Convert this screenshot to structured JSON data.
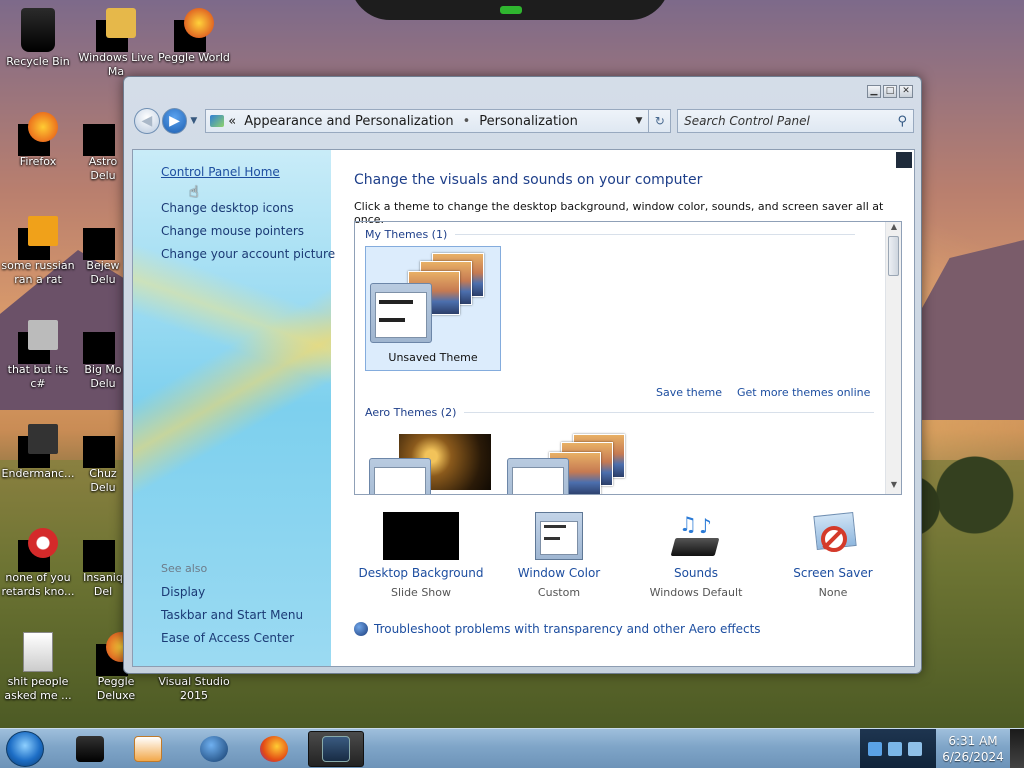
{
  "desktop": {
    "icons": [
      {
        "label": "Recycle Bin",
        "icon": "recycle-bin-icon"
      },
      {
        "label": "Windows Live Ma",
        "icon": "windows-live-icon"
      },
      {
        "label": "Peggle World",
        "icon": "peggle-icon"
      },
      {
        "label": "Firefox",
        "icon": "firefox-icon"
      },
      {
        "label": "Astro Delu",
        "icon": "game-icon"
      },
      {
        "label": "some russian ran a rat",
        "icon": "program-icon"
      },
      {
        "label": "Bejew Delu",
        "icon": "game-icon"
      },
      {
        "label": "that but its c#",
        "icon": "program-icon"
      },
      {
        "label": "Big Mo Delu",
        "icon": "game-icon"
      },
      {
        "label": "Endermanc...",
        "icon": "program-icon"
      },
      {
        "label": "Chuz Delu",
        "icon": "game-icon"
      },
      {
        "label": "none of you retards kno...",
        "icon": "program-icon"
      },
      {
        "label": "Insaniq Del",
        "icon": "game-icon"
      },
      {
        "label": "shit people asked me ...",
        "icon": "file-icon"
      },
      {
        "label": "Peggle Deluxe",
        "icon": "peggle-icon"
      },
      {
        "label": "Visual Studio 2015",
        "icon": "visual-studio-icon"
      }
    ]
  },
  "window": {
    "breadcrumb": {
      "overflow": "«",
      "category": "Appearance and Personalization",
      "separator": "•",
      "page": "Personalization"
    },
    "search_placeholder": "Search Control Panel",
    "left_pane": {
      "links": [
        "Control Panel Home",
        "Change desktop icons",
        "Change mouse pointers",
        "Change your account picture"
      ],
      "see_also_header": "See also",
      "see_also": [
        "Display",
        "Taskbar and Start Menu",
        "Ease of Access Center"
      ]
    },
    "main": {
      "title": "Change the visuals and sounds on your computer",
      "subtitle": "Click a theme to change the desktop background, window color, sounds, and screen saver all at once.",
      "groups": {
        "my_themes": "My Themes (1)",
        "aero_themes": "Aero Themes (2)"
      },
      "unsaved_theme": "Unsaved Theme",
      "save_theme": "Save theme",
      "get_more": "Get more themes online",
      "bottom": [
        {
          "label": "Desktop Background",
          "sub": "Slide Show"
        },
        {
          "label": "Window Color",
          "sub": "Custom"
        },
        {
          "label": "Sounds",
          "sub": "Windows Default"
        },
        {
          "label": "Screen Saver",
          "sub": "None"
        }
      ],
      "troubleshoot": "Troubleshoot problems with transparency and other Aero effects"
    }
  },
  "taskbar": {
    "time": "6:31 AM",
    "date": "6/26/2024"
  }
}
